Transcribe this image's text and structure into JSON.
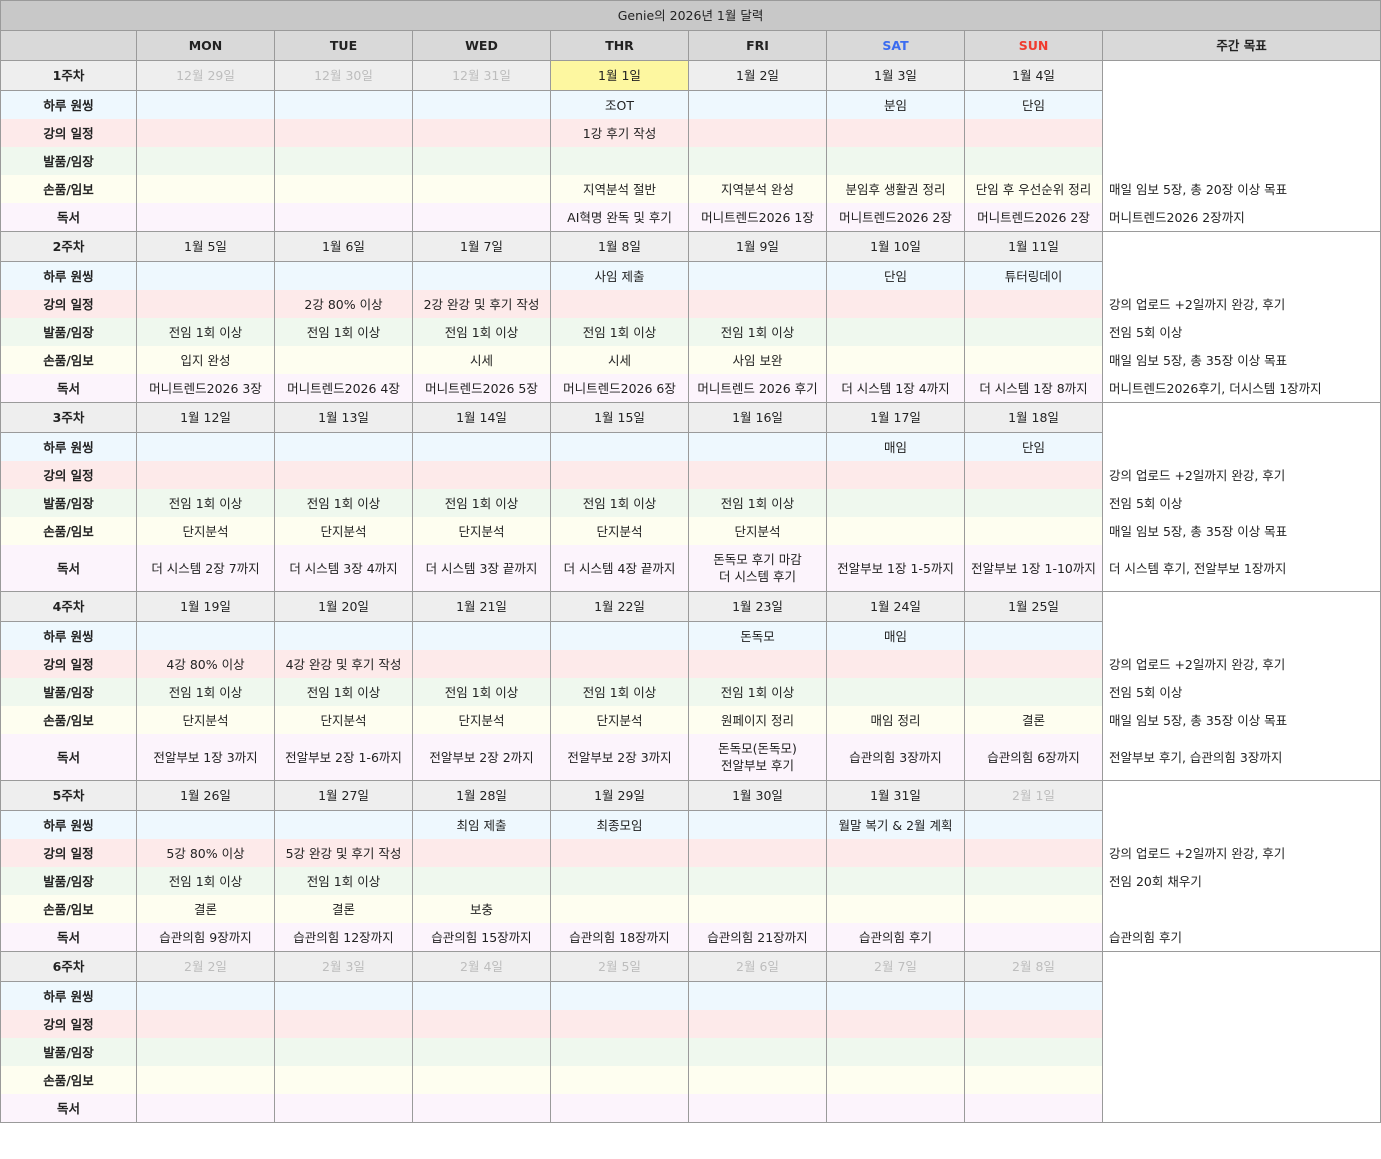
{
  "title": "Genie의 2026년 1월 달력",
  "header": {
    "corner": "",
    "days": [
      "MON",
      "TUE",
      "WED",
      "THR",
      "FRI",
      "SAT",
      "SUN"
    ],
    "goals": "주간 목표"
  },
  "colors": {
    "sat": "#3b6cf0",
    "sun": "#f03c2e",
    "highlight": "#fdf7a0"
  },
  "categories": [
    "하루 원씽",
    "강의 일정",
    "발품/임장",
    "손품/임보",
    "독서"
  ],
  "weeks": [
    {
      "label": "1주차",
      "dates": [
        "12월 29일",
        "12월 30일",
        "12월 31일",
        "1월 1일",
        "1월 2일",
        "1월 3일",
        "1월 4일"
      ],
      "muted": [
        0,
        1,
        2
      ],
      "highlight": [
        3
      ],
      "rows": [
        [
          "",
          "",
          "",
          "조OT",
          "",
          "분임",
          "단임"
        ],
        [
          "",
          "",
          "",
          "1강 후기 작성",
          "",
          "",
          ""
        ],
        [
          "",
          "",
          "",
          "",
          "",
          "",
          ""
        ],
        [
          "",
          "",
          "",
          "지역분석 절반",
          "지역분석 완성",
          "분임후 생활권 정리",
          "단임 후 우선순위 정리"
        ],
        [
          "",
          "",
          "",
          "AI혁명 완독 및 후기",
          "머니트렌드2026 1장",
          "머니트렌드2026 2장",
          "머니트렌드2026 2장"
        ]
      ],
      "goals": [
        "",
        "",
        "",
        "매일 임보 5장, 총 20장 이상 목표",
        "머니트렌드2026 2장까지"
      ]
    },
    {
      "label": "2주차",
      "dates": [
        "1월 5일",
        "1월 6일",
        "1월 7일",
        "1월 8일",
        "1월 9일",
        "1월 10일",
        "1월 11일"
      ],
      "muted": [],
      "highlight": [],
      "rows": [
        [
          "",
          "",
          "",
          "사임 제출",
          "",
          "단임",
          "튜터링데이"
        ],
        [
          "",
          "2강 80% 이상",
          "2강 완강 및 후기 작성",
          "",
          "",
          "",
          ""
        ],
        [
          "전임 1회 이상",
          "전임 1회 이상",
          "전임 1회 이상",
          "전임 1회 이상",
          "전임 1회 이상",
          "",
          ""
        ],
        [
          "입지 완성",
          "",
          "시세",
          "시세",
          "사임 보완",
          "",
          ""
        ],
        [
          "머니트렌드2026 3장",
          "머니트렌드2026 4장",
          "머니트렌드2026 5장",
          "머니트렌드2026 6장",
          "머니트렌드 2026 후기",
          "더 시스템 1장 4까지",
          "더 시스템 1장 8까지"
        ]
      ],
      "goals": [
        "",
        "강의 업로드 +2일까지 완강, 후기",
        "전임 5회 이상",
        "매일 임보 5장, 총 35장 이상 목표",
        "머니트렌드2026후기, 더시스템 1장까지"
      ]
    },
    {
      "label": "3주차",
      "dates": [
        "1월 12일",
        "1월 13일",
        "1월 14일",
        "1월 15일",
        "1월 16일",
        "1월 17일",
        "1월 18일"
      ],
      "muted": [],
      "highlight": [],
      "rows": [
        [
          "",
          "",
          "",
          "",
          "",
          "매임",
          "단임"
        ],
        [
          "",
          "",
          "",
          "",
          "",
          "",
          ""
        ],
        [
          "전임 1회 이상",
          "전임 1회 이상",
          "전임 1회 이상",
          "전임 1회 이상",
          "전임 1회 이상",
          "",
          ""
        ],
        [
          "단지분석",
          "단지분석",
          "단지분석",
          "단지분석",
          "단지분석",
          "",
          ""
        ],
        [
          "더 시스템 2장 7까지",
          "더 시스템 3장 4까지",
          "더 시스템 3장 끝까지",
          "더 시스템 4장 끝까지",
          "돈독모 후기 마감\n더 시스템 후기",
          "전알부보 1장 1-5까지",
          "전알부보 1장 1-10까지"
        ]
      ],
      "goals": [
        "",
        "강의 업로드 +2일까지 완강, 후기",
        "전임 5회 이상",
        "매일 임보 5장, 총 35장 이상 목표",
        "더 시스템 후기, 전알부보 1장까지"
      ]
    },
    {
      "label": "4주차",
      "dates": [
        "1월 19일",
        "1월 20일",
        "1월 21일",
        "1월 22일",
        "1월 23일",
        "1월 24일",
        "1월 25일"
      ],
      "muted": [],
      "highlight": [],
      "rows": [
        [
          "",
          "",
          "",
          "",
          "돈독모",
          "매임",
          ""
        ],
        [
          "4강 80% 이상",
          "4강 완강 및 후기 작성",
          "",
          "",
          "",
          "",
          ""
        ],
        [
          "전임 1회 이상",
          "전임 1회 이상",
          "전임 1회 이상",
          "전임 1회 이상",
          "전임 1회 이상",
          "",
          ""
        ],
        [
          "단지분석",
          "단지분석",
          "단지분석",
          "단지분석",
          "원페이지 정리",
          "매임 정리",
          "결론"
        ],
        [
          "전알부보 1장 3까지",
          "전알부보 2장 1-6까지",
          "전알부보 2장 2까지",
          "전알부보 2장 3까지",
          "돈독모(돈독모)\n전알부보 후기",
          "습관의힘 3장까지",
          "습관의힘 6장까지"
        ]
      ],
      "goals": [
        "",
        "강의 업로드 +2일까지 완강, 후기",
        "전임 5회 이상",
        "매일 임보 5장, 총 35장 이상 목표",
        "전알부보 후기, 습관의힘 3장까지"
      ]
    },
    {
      "label": "5주차",
      "dates": [
        "1월 26일",
        "1월 27일",
        "1월 28일",
        "1월 29일",
        "1월 30일",
        "1월 31일",
        "2월 1일"
      ],
      "muted": [
        6
      ],
      "highlight": [],
      "rows": [
        [
          "",
          "",
          "최임 제출",
          "최종모임",
          "",
          "월말 복기 & 2월 계획",
          ""
        ],
        [
          "5강 80% 이상",
          "5강 완강 및 후기 작성",
          "",
          "",
          "",
          "",
          ""
        ],
        [
          "전임 1회 이상",
          "전임 1회 이상",
          "",
          "",
          "",
          "",
          ""
        ],
        [
          "결론",
          "결론",
          "보충",
          "",
          "",
          "",
          ""
        ],
        [
          "습관의힘 9장까지",
          "습관의힘 12장까지",
          "습관의힘 15장까지",
          "습관의힘 18장까지",
          "습관의힘 21장까지",
          "습관의힘 후기",
          ""
        ]
      ],
      "goals": [
        "",
        "강의 업로드 +2일까지 완강, 후기",
        "전임 20회 채우기",
        "",
        "습관의힘 후기"
      ]
    },
    {
      "label": "6주차",
      "dates": [
        "2월 2일",
        "2월 3일",
        "2월 4일",
        "2월 5일",
        "2월 6일",
        "2월 7일",
        "2월 8일"
      ],
      "muted": [
        0,
        1,
        2,
        3,
        4,
        5,
        6
      ],
      "highlight": [],
      "rows": [
        [
          "",
          "",
          "",
          "",
          "",
          "",
          ""
        ],
        [
          "",
          "",
          "",
          "",
          "",
          "",
          ""
        ],
        [
          "",
          "",
          "",
          "",
          "",
          "",
          ""
        ],
        [
          "",
          "",
          "",
          "",
          "",
          "",
          ""
        ],
        [
          "",
          "",
          "",
          "",
          "",
          "",
          ""
        ]
      ],
      "goals": [
        "",
        "",
        "",
        "",
        ""
      ]
    }
  ]
}
